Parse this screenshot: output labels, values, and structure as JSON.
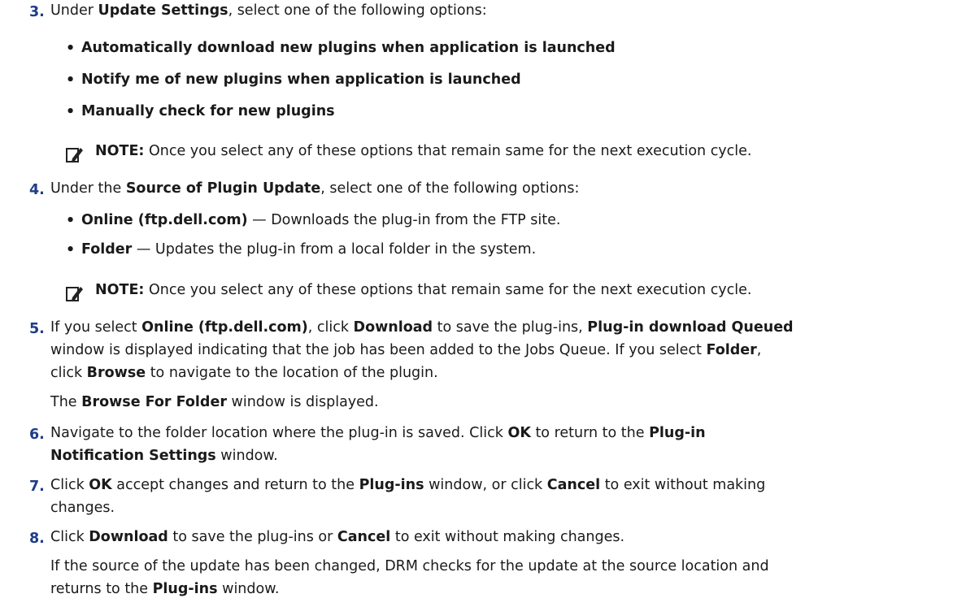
{
  "steps": [
    {
      "number": "3.",
      "pre": "Under ",
      "bold1": "Update Settings",
      "post": ", select one of the following options:",
      "options": [
        "Automatically download new plugins when application is launched",
        "Notify me of new plugins when application is launched",
        "Manually check for new plugins"
      ],
      "note_label": "NOTE:",
      "note_text": " Once you select any of these options that remain same for the next execution cycle."
    },
    {
      "number": "4.",
      "pre": "Under the ",
      "bold1": "Source of Plugin Update",
      "post": ", select one of the following options:",
      "options": [
        {
          "term": "Online (ftp.dell.com)",
          "desc": " — Downloads the plug-in from the FTP site."
        },
        {
          "term": "Folder",
          "desc": " — Updates the plug-in from a local folder in the system."
        }
      ],
      "note_label": "NOTE:",
      "note_text": " Once you select any of these options that remain same for the next execution cycle."
    },
    {
      "number": "5.",
      "l1_a": "If you select ",
      "l1_b": "Online (ftp.dell.com)",
      "l1_c": ", click ",
      "l1_d": "Download",
      "l1_e": " to save the plug-ins, ",
      "l1_f": "Plug-in download Queued",
      "l2_a": "window is displayed indicating that the job has been added to the Jobs Queue. If you select ",
      "l2_b": "Folder",
      "l2_c": ",",
      "l3_a": "click ",
      "l3_b": "Browse",
      "l3_c": " to navigate to the location of the plugin.",
      "r_a": "The ",
      "r_b": "Browse For Folder",
      "r_c": " window is displayed."
    },
    {
      "number": "6.",
      "l1_a": "Navigate to the folder location where the plug-in is saved. Click ",
      "l1_b": "OK",
      "l1_c": " to return to the ",
      "l1_d": "Plug-in",
      "l2_a": "Notification Settings",
      "l2_b": " window."
    },
    {
      "number": "7.",
      "l1_a": "Click ",
      "l1_b": "OK",
      "l1_c": " accept changes and return to the ",
      "l1_d": "Plug-ins",
      "l1_e": " window, or click ",
      "l1_f": "Cancel",
      "l1_g": " to exit without making",
      "l2_a": "changes."
    },
    {
      "number": "8.",
      "l1_a": "Click ",
      "l1_b": "Download",
      "l1_c": " to save the plug-ins or ",
      "l1_d": "Cancel",
      "l1_e": " to exit without making changes.",
      "r1": "If the source of the update has been changed, DRM checks for the update at the source location and",
      "r2_a": "returns to the ",
      "r2_b": "Plug-ins",
      "r2_c": " window."
    }
  ],
  "colors": {
    "accent": "#1f3c88",
    "text": "#1a1a1a"
  },
  "icons": {
    "note": "pencil-note-icon"
  }
}
